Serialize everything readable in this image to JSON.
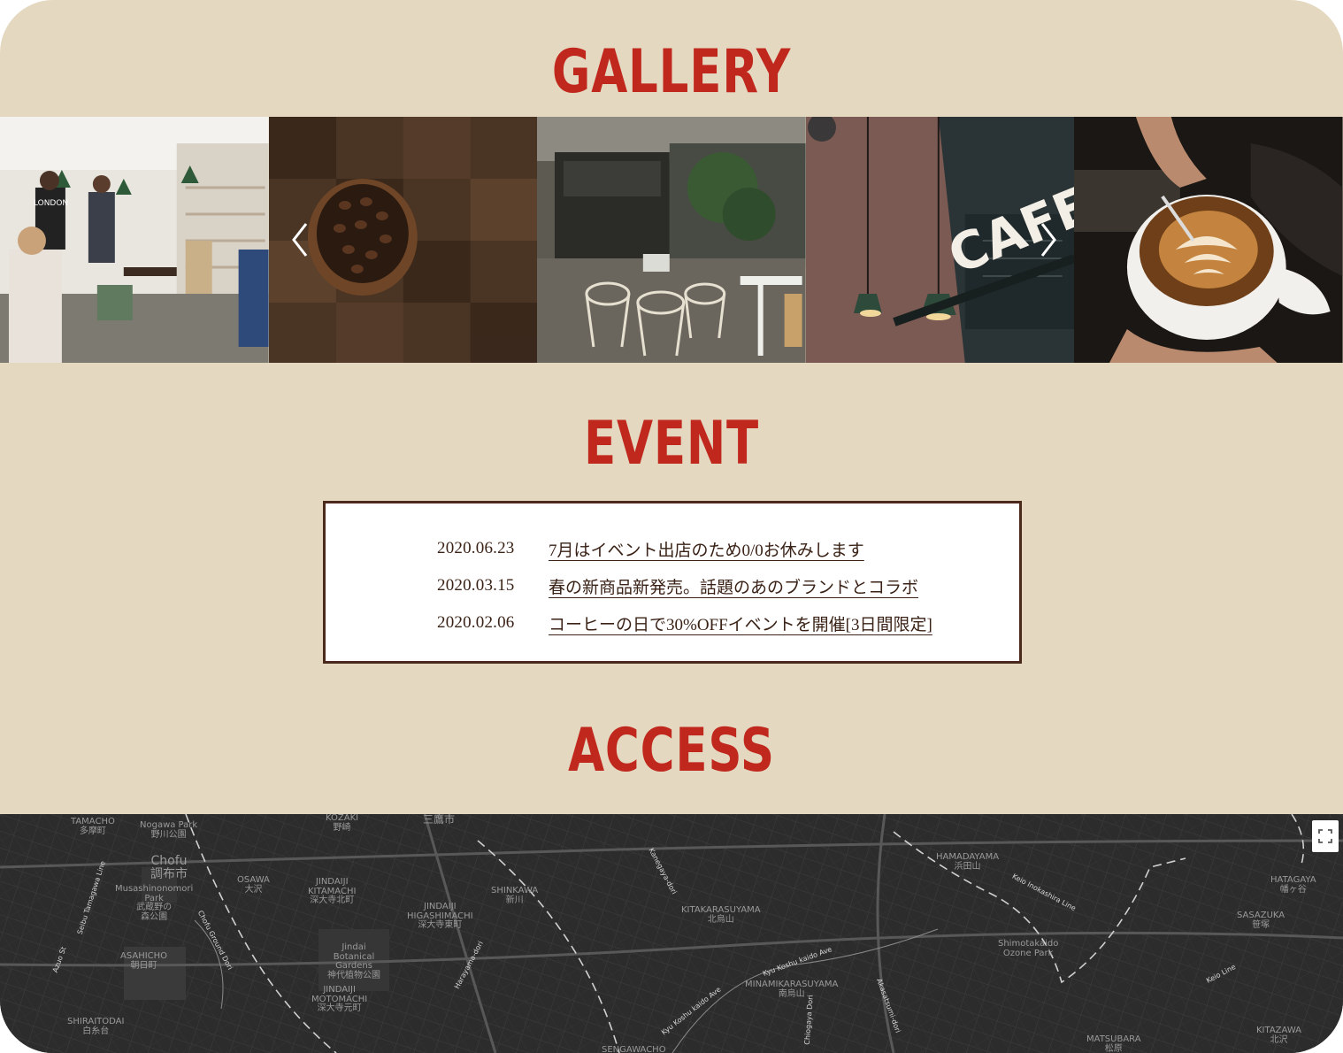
{
  "gallery": {
    "title": "GALLERY",
    "photos": [
      {
        "alt": "busy cafe interior"
      },
      {
        "alt": "coffee beans in bowl"
      },
      {
        "alt": "cafe seating area"
      },
      {
        "alt": "cafe neon sign"
      },
      {
        "alt": "latte art"
      }
    ],
    "neon_sign": "CAFE",
    "shirt_text": "LONDON",
    "prev_icon": "chevron-left-icon",
    "next_icon": "chevron-right-icon"
  },
  "event": {
    "title": "EVENT",
    "items": [
      {
        "date": "2020.06.23",
        "text": "7月はイベント出店のため0/0お休みします"
      },
      {
        "date": "2020.03.15",
        "text": "春の新商品新発売。話題のあのブランドとコラボ"
      },
      {
        "date": "2020.02.06",
        "text": "コーヒーの日で30%OFFイベントを開催[3日間限定]"
      }
    ]
  },
  "access": {
    "title": "ACCESS",
    "fullscreen_icon": "fullscreen-icon",
    "map_labels": [
      {
        "text": "TAMACHO\n多摩町"
      },
      {
        "text": "Nogawa Park\n野川公園"
      },
      {
        "text": "Chofu\n調布市"
      },
      {
        "text": "Musashinonomori\nPark\n武蔵野の\n森公園"
      },
      {
        "text": "OSAWA\n大沢"
      },
      {
        "text": "JINDAIJI\nKITAMACHI\n深大寺北町"
      },
      {
        "text": "JINDAIJI\nHIGASHIMACHI\n深大寺東町"
      },
      {
        "text": "Jindai\nBotanical\nGardens\n神代植物公園"
      },
      {
        "text": "JINDAIJI\nMOTOMACHI\n深大寺元町"
      },
      {
        "text": "ASAHICHO\n朝日町"
      },
      {
        "text": "SHIRAITODAI\n白糸台"
      },
      {
        "text": "SHINKAWA\n新川"
      },
      {
        "text": "KITAKARASUYAMA\n北烏山"
      },
      {
        "text": "MINAMIKARASUYAMA\n南烏山"
      },
      {
        "text": "HAMADAYAMA\n浜田山"
      },
      {
        "text": "Shimotakaido\nOzone Park"
      },
      {
        "text": "SASAZUKA\n笹塚"
      },
      {
        "text": "HATAGAYA\n幡ヶ谷"
      },
      {
        "text": "MATSUBARA\n松原"
      },
      {
        "text": "KITAZAWA\n北沢"
      },
      {
        "text": "三鷹市"
      },
      {
        "text": "KOZAKI\n野崎"
      },
      {
        "text": "SENGAWACHO"
      }
    ],
    "road_labels": [
      {
        "text": "Kanegaya-dori"
      },
      {
        "text": "Kyu Koshu kaido Ave"
      },
      {
        "text": "Kyu Koshu kaido Ave"
      },
      {
        "text": "Harayama-dori"
      },
      {
        "text": "Chofu Ground Dori"
      },
      {
        "text": "Akasatsumi-dori"
      },
      {
        "text": "Chiogaya Dori"
      },
      {
        "text": "Keio Inokashira Line"
      },
      {
        "text": "Keio Line"
      },
      {
        "text": "Azuo St"
      },
      {
        "text": "Seibu Tamagawa Line"
      }
    ]
  }
}
